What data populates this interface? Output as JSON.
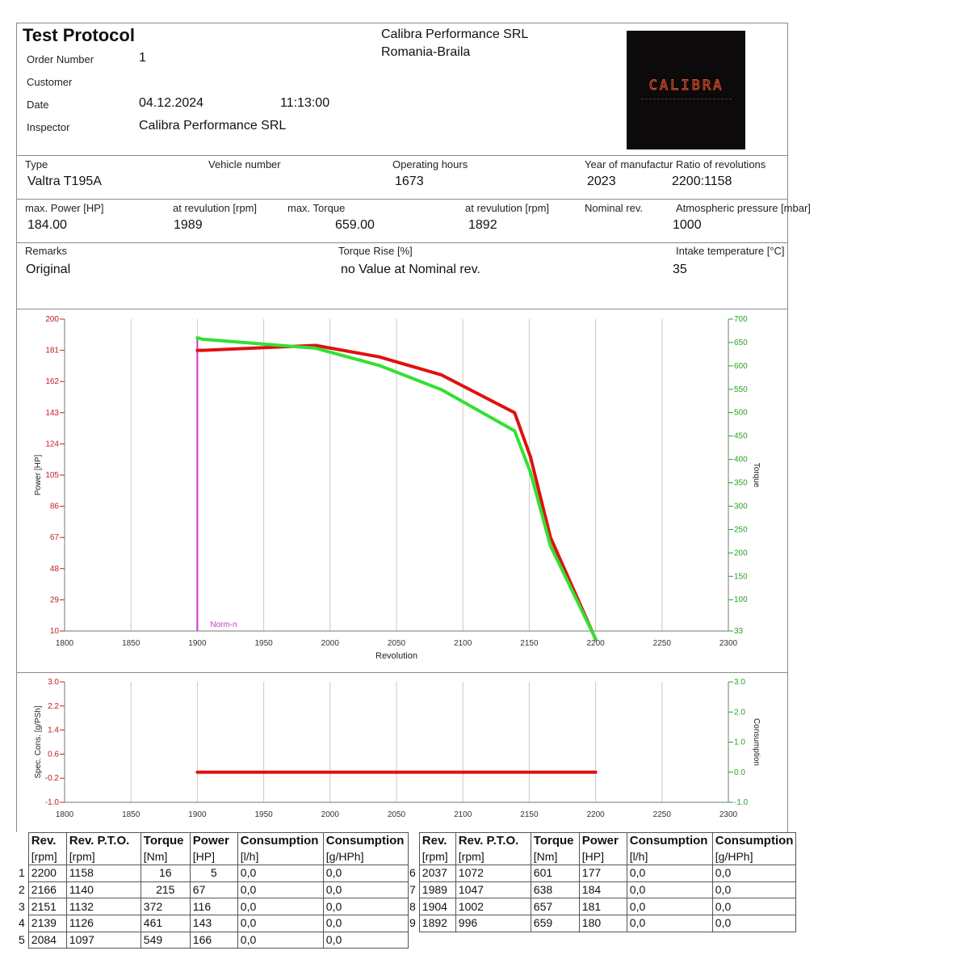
{
  "header": {
    "title": "Test Protocol",
    "company_line1": "Calibra Performance SRL",
    "company_line2": "Romania-Braila",
    "logo_text": "CALIBRA",
    "order_number_label": "Order Number",
    "order_number": "1",
    "customer_label": "Customer",
    "customer": "",
    "date_label": "Date",
    "date": "04.12.2024",
    "time": "11:13:00",
    "inspector_label": "Inspector",
    "inspector": "Calibra Performance SRL"
  },
  "vehicle": {
    "type_label": "Type",
    "type": "Valtra T195A",
    "vehicle_number_label": "Vehicle number",
    "vehicle_number": "",
    "operating_hours_label": "Operating hours",
    "operating_hours": "1673",
    "year_label": "Year of manufactur",
    "year": "2023",
    "ratio_label": "Ratio of revolutions",
    "ratio": "2200:1158"
  },
  "summary": {
    "max_power_label": "max. Power [HP]",
    "max_power": "184.00",
    "power_rev_label": "at revulution [rpm]",
    "power_rev": "1989",
    "max_torque_label": "max. Torque",
    "max_torque": "659.00",
    "torque_rev_label": "at revulution [rpm]",
    "torque_rev": "1892",
    "nominal_rev_label": "Nominal rev.",
    "nominal_rev": "",
    "pressure_label": "Atmospheric pressure [mbar]",
    "pressure": "1000"
  },
  "remarks": {
    "remarks_label": "Remarks",
    "remarks": "Original",
    "torque_rise_label": "Torque Rise [%]",
    "torque_rise": "no Value at Nominal rev.",
    "intake_label": "Intake temperature [°C]",
    "intake": "35"
  },
  "chart_data": [
    {
      "type": "line",
      "xlabel": "Revolution",
      "ylabel": "Power [HP]",
      "y2label": "Torque",
      "xlim": [
        1800,
        2300
      ],
      "ylim": [
        10,
        200
      ],
      "y2lim": [
        33,
        700
      ],
      "x_ticks": [
        1800,
        1850,
        1900,
        1950,
        2000,
        2050,
        2100,
        2150,
        2200,
        2250,
        2300
      ],
      "y_ticks": [
        10,
        29,
        48,
        67,
        86,
        105,
        124,
        143,
        162,
        181,
        200
      ],
      "y2_ticks": [
        33,
        100,
        150,
        200,
        250,
        300,
        350,
        400,
        450,
        500,
        550,
        600,
        650,
        700
      ],
      "grid": true,
      "marker": {
        "x": 1900,
        "label": "Norm-n",
        "color": "#cc33cc"
      },
      "series": [
        {
          "axis": "left",
          "color": "#e01010",
          "points": [
            [
              1900,
              181
            ],
            [
              1904,
              181
            ],
            [
              1989,
              184
            ],
            [
              2037,
              177
            ],
            [
              2084,
              166
            ],
            [
              2139,
              143
            ],
            [
              2151,
              116
            ],
            [
              2166,
              67
            ],
            [
              2200,
              5
            ]
          ]
        },
        {
          "axis": "right",
          "color": "#33e033",
          "points": [
            [
              1900,
              660
            ],
            [
              1904,
              657
            ],
            [
              1989,
              638
            ],
            [
              2037,
              601
            ],
            [
              2084,
              549
            ],
            [
              2139,
              461
            ],
            [
              2151,
              372
            ],
            [
              2166,
              215
            ],
            [
              2200,
              16
            ]
          ]
        }
      ]
    },
    {
      "type": "line",
      "ylabel": "Spec. Cons. [g/PSh]",
      "y2label": "Consumption",
      "xlim": [
        1800,
        2300
      ],
      "ylim": [
        -1.0,
        3.0
      ],
      "y2lim": [
        -1.0,
        3.0
      ],
      "x_ticks": [
        1800,
        1850,
        1900,
        1950,
        2000,
        2050,
        2100,
        2150,
        2200,
        2250,
        2300
      ],
      "y_ticks": [
        -1.0,
        -0.2,
        0.6,
        1.4,
        2.2,
        3.0
      ],
      "y_tick_labels": [
        "-1.0",
        "-0.2",
        "0.6",
        "1.4",
        "2.2",
        "3.0"
      ],
      "y2_ticks": [
        -1.0,
        0.0,
        1.0,
        2.0,
        3.0
      ],
      "y2_tick_labels": [
        "-1.0",
        "0.0",
        "1.0",
        "2.0",
        "3.0"
      ],
      "grid": true,
      "series": [
        {
          "axis": "left",
          "color": "#e01010",
          "points": [
            [
              1900,
              0.0
            ],
            [
              2200,
              0.0
            ]
          ]
        }
      ]
    }
  ],
  "table": {
    "columns": [
      "Rev.",
      "Rev. P.T.O.",
      "Torque",
      "Power",
      "Consumption",
      "Consumption"
    ],
    "units": [
      "[rpm]",
      "[rpm]",
      "[Nm]",
      "[HP]",
      "[l/h]",
      "[g/HPh]"
    ],
    "left_rows": [
      {
        "n": "1",
        "cells": [
          "2200",
          "1158",
          "16",
          "5",
          "0,0",
          "0,0"
        ]
      },
      {
        "n": "2",
        "cells": [
          "2166",
          "1140",
          "215",
          "67",
          "0,0",
          "0,0"
        ]
      },
      {
        "n": "3",
        "cells": [
          "2151",
          "1132",
          "372",
          "116",
          "0,0",
          "0,0"
        ]
      },
      {
        "n": "4",
        "cells": [
          "2139",
          "1126",
          "461",
          "143",
          "0,0",
          "0,0"
        ]
      },
      {
        "n": "5",
        "cells": [
          "2084",
          "1097",
          "549",
          "166",
          "0,0",
          "0,0"
        ]
      }
    ],
    "right_rows": [
      {
        "n": "6",
        "cells": [
          "2037",
          "1072",
          "601",
          "177",
          "0,0",
          "0,0"
        ]
      },
      {
        "n": "7",
        "cells": [
          "1989",
          "1047",
          "638",
          "184",
          "0,0",
          "0,0"
        ]
      },
      {
        "n": "8",
        "cells": [
          "1904",
          "1002",
          "657",
          "181",
          "0,0",
          "0,0"
        ]
      },
      {
        "n": "9",
        "cells": [
          "1892",
          "996",
          "659",
          "180",
          "0,0",
          "0,0"
        ]
      }
    ]
  }
}
